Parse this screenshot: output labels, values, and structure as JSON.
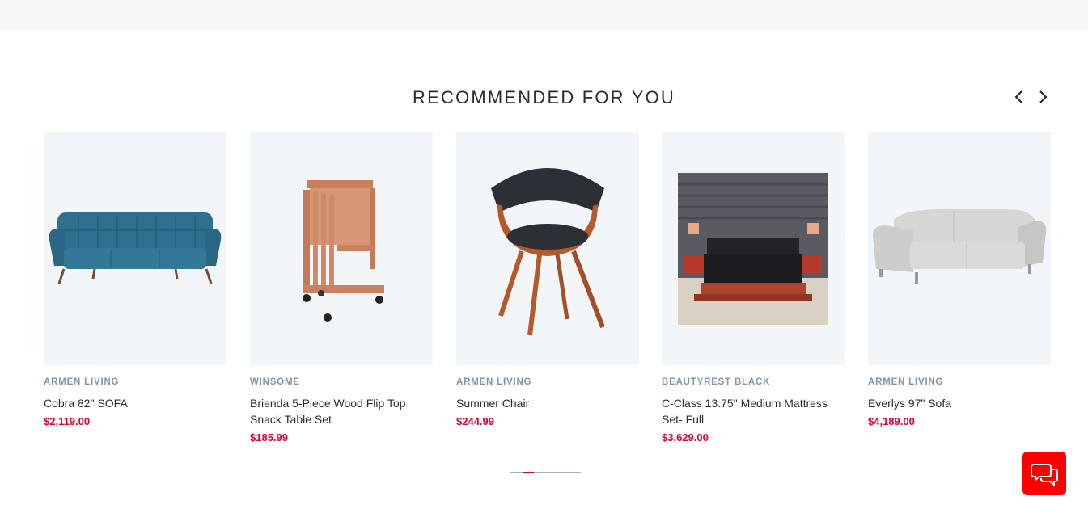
{
  "section": {
    "title": "RECOMMENDED FOR YOU"
  },
  "nav": {
    "prev_icon": "chevron-left-icon",
    "next_icon": "chevron-right-icon"
  },
  "products": [
    {
      "brand": "ARMEN LIVING",
      "name": "Cobra 82\" SOFA",
      "price": "$2,119.00",
      "image": "blue-tufted-sofa"
    },
    {
      "brand": "WINSOME",
      "name": "Brienda 5-Piece Wood Flip Top Snack Table Set",
      "price": "$185.99",
      "image": "wood-snack-table-set"
    },
    {
      "brand": "ARMEN LIVING",
      "name": "Summer Chair",
      "price": "$244.99",
      "image": "bentwood-accent-chair"
    },
    {
      "brand": "BEAUTYREST BLACK",
      "name": "C-Class 13.75\" Medium Mattress Set- Full",
      "price": "$3,629.00",
      "image": "mattress-bedroom-scene"
    },
    {
      "brand": "ARMEN LIVING",
      "name": "Everlys 97\" Sofa",
      "price": "$4,189.00",
      "image": "gray-leather-sofa"
    }
  ],
  "pager": {
    "active_index": 1,
    "pages": 6
  },
  "colors": {
    "price": "#e4002b",
    "brand": "#7f95a8",
    "chat": "#ff0000"
  },
  "chat": {
    "icon": "chat-bubbles-icon"
  }
}
